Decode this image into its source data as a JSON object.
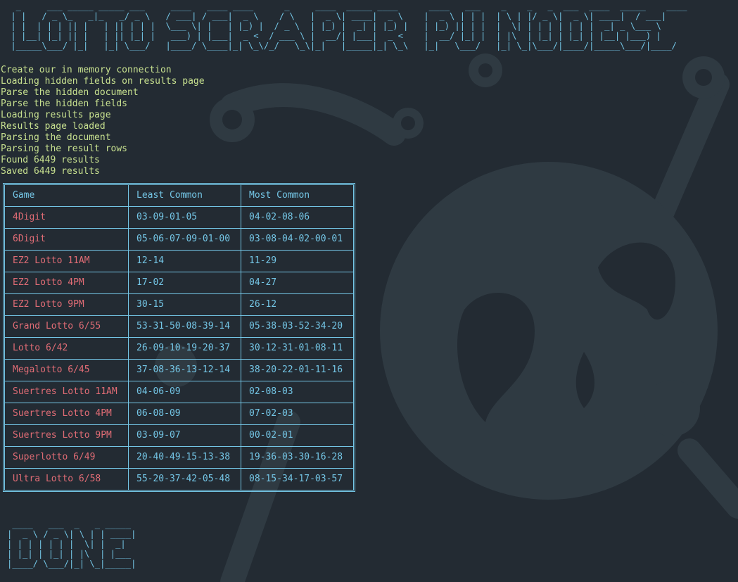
{
  "banner_ascii": "  _     ___ _____ _____ ___     ____   ____ ____      _     ____  _____ ____      ____   ___    _    _   _  ___  ____  _____    ____ \n | |   / _ \\_   _|_   _/ _ \\   / ___| / ___|  _ \\    / \\   |  _ \\| ____|  _ \\    |  _ \\ | | |  | \\ | |/ _ \\|  _ \\| ____|  / ___|\n | |  | | | || |   | || | | |  \\___ \\| |   | |_) |  / _ \\  | |_) |  _| | |_) |   | |_) || | |  |  \\| | | | | | | |  _| _ \\___ \\\n | |__| |_| || |   | || |_| |   ___) | |___|  _ <  / ___ \\ |  __/| |___|  _ <    |  __/ |_| |  | |\\  | |_| | |_| | |__| |___) |\n |_____\\___/ |_|   |_| \\___/   |____/ \\____|_| \\_\\/_/   \\_\\|_|   |_____|_| \\_\\   |_|   \\___/   |_| \\_|\\___/|____/|_____\\___/|____/",
  "log_lines": [
    "Create our in memory connection",
    "Loading hidden fields on results page",
    "Parse the hidden document",
    "Parse the hidden fields",
    "Loading results page",
    "Results page loaded",
    "Parsing the document",
    "Parsing the result rows",
    "Found 6449 results",
    "Saved 6449 results"
  ],
  "table": {
    "headers": [
      "Game",
      "Least Common",
      "Most Common"
    ],
    "rows": [
      [
        "4Digit",
        "03-09-01-05",
        "04-02-08-06"
      ],
      [
        "6Digit",
        "05-06-07-09-01-00",
        "03-08-04-02-00-01"
      ],
      [
        "EZ2 Lotto 11AM",
        "12-14",
        "11-29"
      ],
      [
        "EZ2 Lotto 4PM",
        "17-02",
        "04-27"
      ],
      [
        "EZ2 Lotto 9PM",
        "30-15",
        "26-12"
      ],
      [
        "Grand Lotto 6/55",
        "53-31-50-08-39-14",
        "05-38-03-52-34-20"
      ],
      [
        "Lotto 6/42",
        "26-09-10-19-20-37",
        "30-12-31-01-08-11"
      ],
      [
        "Megalotto 6/45",
        "37-08-36-13-12-14",
        "38-20-22-01-11-16"
      ],
      [
        "Suertres Lotto 11AM",
        "04-06-09",
        "02-08-03"
      ],
      [
        "Suertres Lotto 4PM",
        "06-08-09",
        "07-02-03"
      ],
      [
        "Suertres Lotto 9PM",
        "03-09-07",
        "00-02-01"
      ],
      [
        "Superlotto 6/49",
        "20-40-49-15-13-38",
        "19-36-03-30-16-28"
      ],
      [
        "Ultra Lotto 6/58",
        "55-20-37-42-05-48",
        "08-15-34-17-03-57"
      ]
    ]
  },
  "done_ascii": " ____   ___  _   _ _____\n|  _ \\ / _ \\| \\ | | ____|\n| | | | | | |  \\| |  _|\n| |_| | |_| | |\\  | |___\n|____/ \\___/|_| \\_|_____|",
  "colors": {
    "background": "#232b33",
    "log_text": "#c7e08f",
    "accent_cyan": "#74c6e6",
    "game_red": "#e06c75",
    "art_shade": "#2f3a42"
  },
  "background_art_icon": "skull-circuit-icon"
}
